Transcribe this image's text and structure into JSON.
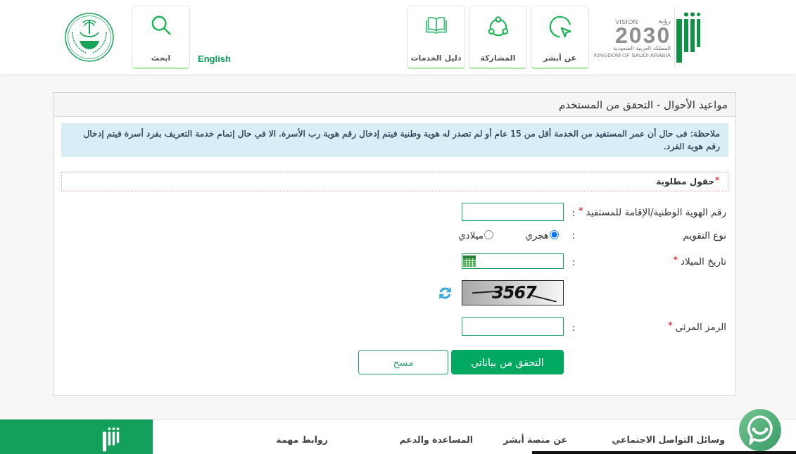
{
  "header": {
    "nav": [
      {
        "label": "عن أبشر"
      },
      {
        "label": "المشاركة"
      },
      {
        "label": "دليل الخدمات"
      }
    ],
    "vision_logo": {
      "word": "VISION",
      "arabic_word": "رؤية",
      "year": "2030",
      "country_ar": "المملكة العربية السعودية",
      "country_en": "KINGDOM OF SAUDI ARABIA"
    },
    "language_link": "English",
    "search": {
      "label": "ابحث"
    }
  },
  "panel": {
    "title": "مواعيد الأحوال - التحقق من المستخدم",
    "note": "ملاحظة: فى حال أن عمر المستفيد من الخدمة أقل من 15 عام أو لم تصدر له هوية وطنية فيتم إدخال رقم هوية رب الأسرة. الا في حال إتمام خدمة التعريف بفرد أسرة فيتم إدخال رقم هوية الفرد.",
    "required_notice": {
      "mark": "*",
      "text": "حقول مطلوبة"
    }
  },
  "form": {
    "fields": [
      {
        "kind": "text",
        "label": "رقم الهوية الوطنية/الإقامة للمستفيد",
        "mark": "*",
        "colon": ":"
      },
      {
        "kind": "radio",
        "label": "نوع التقويم",
        "colon": ":",
        "options": [
          {
            "label": "هجري",
            "selected": true
          },
          {
            "label": "ميلادي",
            "selected": false
          }
        ]
      },
      {
        "kind": "date",
        "label": "تاريخ الميلاد",
        "mark": "*",
        "colon": ":"
      },
      {
        "kind": "captcha",
        "code": "3567"
      },
      {
        "kind": "text",
        "label": "الرمز المرئي",
        "mark": "*",
        "colon": ":"
      }
    ],
    "buttons": [
      {
        "kind": "primary",
        "label": "التحقق من بياناتي"
      },
      {
        "kind": "secondary",
        "label": "مسح"
      }
    ]
  },
  "footer": {
    "columns": [
      {
        "heading": "وسائل التواصل الاجتماعي"
      },
      {
        "heading": "عن منصة أبشر"
      },
      {
        "heading": "المساعدة والدعم"
      },
      {
        "heading": "روابط مهمة"
      }
    ]
  }
}
